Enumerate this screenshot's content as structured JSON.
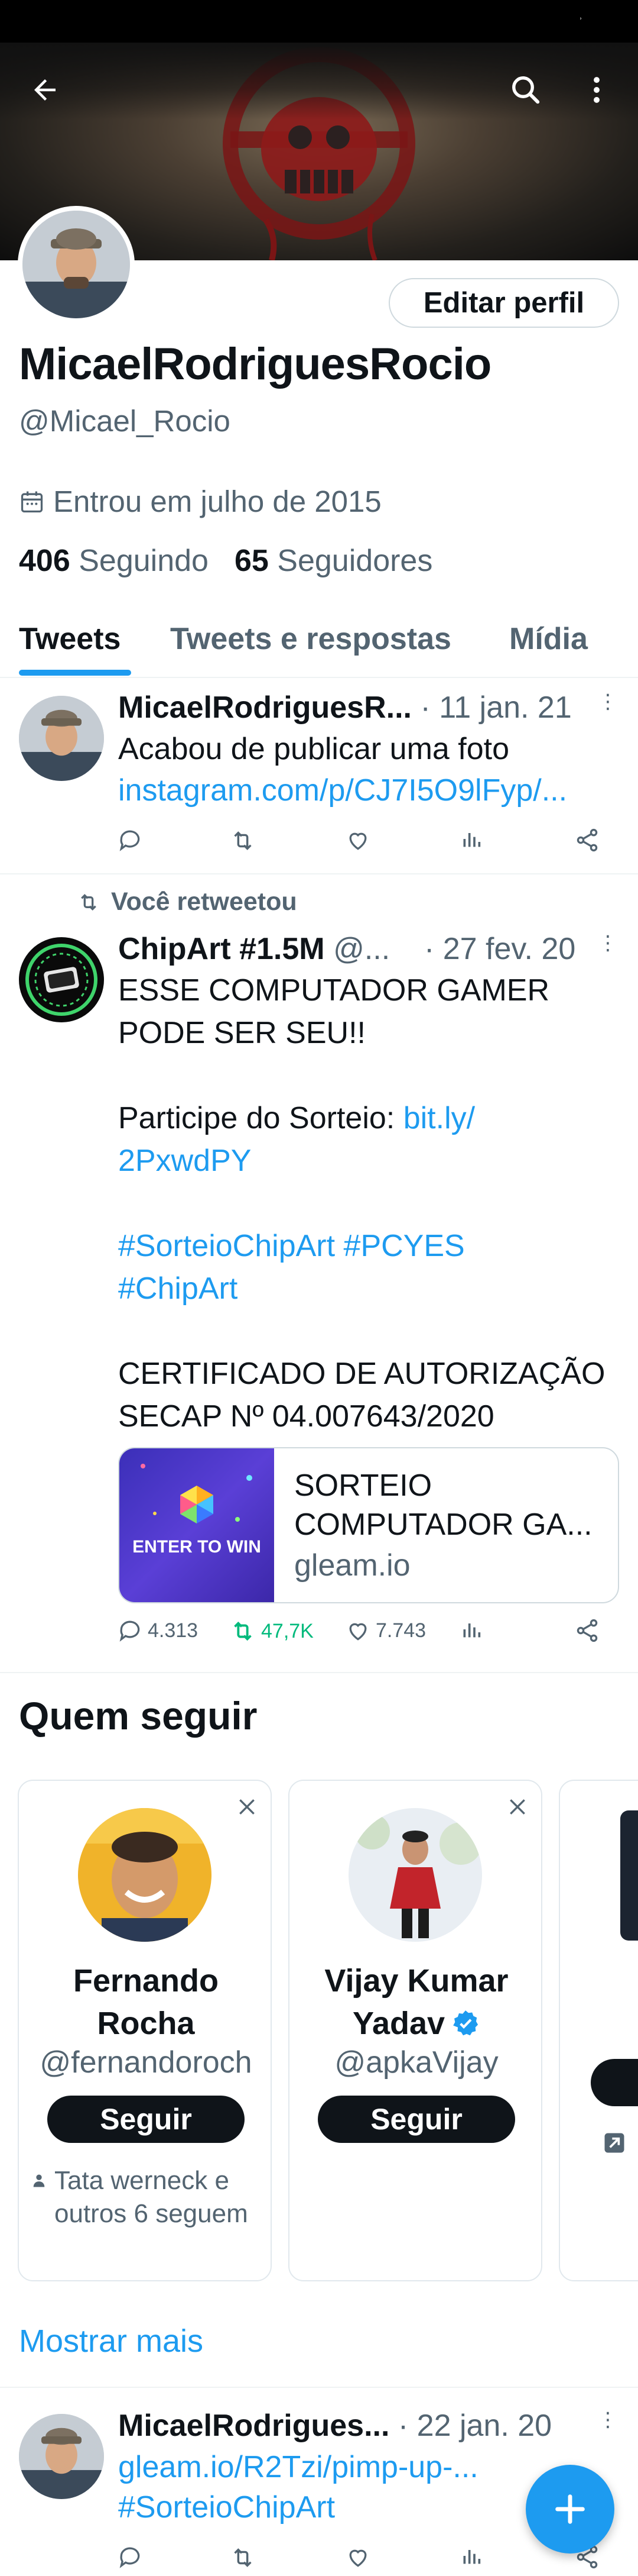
{
  "header": {
    "back_icon": "back-arrow-icon",
    "search_icon": "search-icon",
    "more_icon": "more-vertical-icon"
  },
  "profile": {
    "name": "MicaelRodriguesRocio",
    "handle": "@Micael_Rocio",
    "joined": "Entrou em julho de 2015",
    "following_count": "406",
    "following_label": "Seguindo",
    "followers_count": "65",
    "followers_label": "Seguidores",
    "edit_label": "Editar perfil"
  },
  "tabs": [
    {
      "label": "Tweets",
      "active": true
    },
    {
      "label": "Tweets e respostas",
      "active": false
    },
    {
      "label": "Mídia",
      "active": false
    }
  ],
  "tweets": [
    {
      "author": "MicaelRodriguesR...",
      "date": "· 11 jan. 21",
      "text": "Acabou de publicar uma foto",
      "link": "instagram.com/p/CJ7I5O9lFyp/..."
    },
    {
      "retweet_label": "Você retweetou",
      "author": "ChipArt #1.5M",
      "handle": "@...",
      "date": "· 27 fev. 20",
      "line1": "ESSE COMPUTADOR GAMER",
      "line2": "PODE SER SEU!!",
      "line3": "Participe do Sorteio: ",
      "link_a": "bit.ly/",
      "link_b": "2PxwdPY",
      "hashtags_a": "#SorteioChipArt  #PCYES",
      "hashtags_b": "#ChipArt",
      "line4": "CERTIFICADO DE AUTORIZAÇÃO",
      "line5": "SECAP Nº  04.007643/2020",
      "card": {
        "thumb_text": "ENTER TO WIN",
        "title_1": "SORTEIO",
        "title_2": "COMPUTADOR GA...",
        "domain": "gleam.io"
      },
      "replies": "4.313",
      "retweets": "47,7K",
      "likes": "7.743"
    },
    {
      "author": "MicaelRodrigues...",
      "date": "· 22 jan. 20",
      "link": "gleam.io/R2Tzi/pimp-up-...",
      "hashtag": "#SorteioChipArt"
    }
  ],
  "who_to_follow": {
    "title": "Quem seguir",
    "follow_label": "Seguir",
    "show_more": "Mostrar mais",
    "cards": [
      {
        "name_1": "Fernando",
        "name_2": "Rocha",
        "handle": "@fernandoroch",
        "context": "Tata werneck e outros 6 seguem"
      },
      {
        "name_1": "Vijay Kumar",
        "name_2": "Yadav",
        "handle": "@apkaVijay",
        "verified": true
      }
    ]
  },
  "colors": {
    "accent": "#1d9bf0",
    "text": "#0f1419",
    "muted": "#536471",
    "retweet": "#00ba7c"
  }
}
